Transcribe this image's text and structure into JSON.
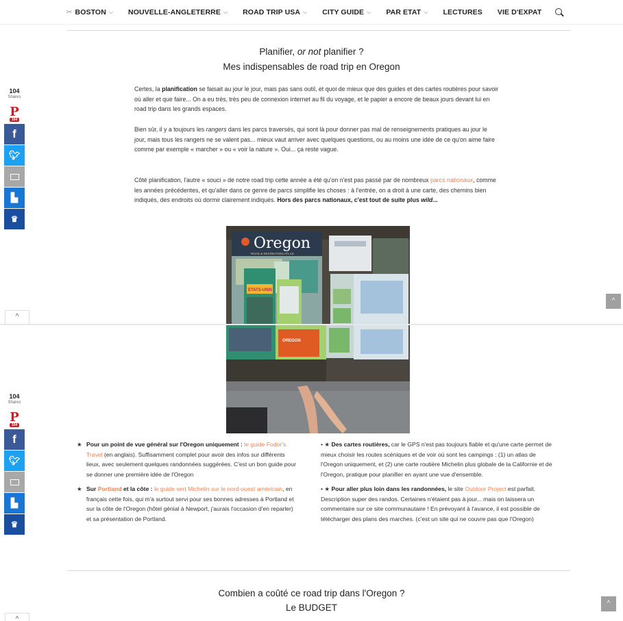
{
  "nav": {
    "items": [
      {
        "label": "BOSTON",
        "prefix": "✂",
        "dropdown": true
      },
      {
        "label": "NOUVELLE-ANGLETERRE",
        "dropdown": true
      },
      {
        "label": "ROAD TRIP USA",
        "dropdown": true
      },
      {
        "label": "CITY GUIDE",
        "dropdown": true
      },
      {
        "label": "PAR ETAT",
        "dropdown": true
      },
      {
        "label": "LECTURES",
        "dropdown": false
      },
      {
        "label": "VIE D'EXPAT",
        "dropdown": false
      }
    ],
    "search_icon": "search-icon"
  },
  "share": {
    "count": "104",
    "label": "Shares",
    "pin_count": "104",
    "buttons": [
      "pinterest",
      "facebook",
      "twitter",
      "email",
      "flipboard",
      "crown"
    ],
    "colors": {
      "pinterest": "#cb2027",
      "facebook": "#3b5998",
      "twitter": "#1da1f2",
      "email": "#a8a8a8",
      "flipboard": "#1877d4",
      "crown": "#1a4fa0"
    }
  },
  "section1": {
    "title_a": "Planifier, ",
    "title_em": "or not",
    "title_b": " planifier ?",
    "subtitle": "Mes indispensables de road trip en Oregon",
    "p1_a": "Certes, la ",
    "p1_bold": "planification",
    "p1_b": " se faisait au jour le jour, mais pas sans outil, et quoi de mieux que des guides et des cartes routières pour savoir où aller et que faire... On a eu très, très peu de connexion internet au fil du voyage, et le papier a encore de beaux jours devant lui en road trip dans les grands espaces.",
    "p2_a": "Bien sûr, il y a toujours les ",
    "p2_em": "rangers",
    "p2_b": " dans les parcs traversés, qui sont là pour donner pas mal de renseignements pratiques au jour le jour, mais tous les rangers ne se valent pas... mieux vaut arriver avec quelques questions, ou au moins une idée de ce qu'on aime faire comme par exemple « marcher » ou « voir la nature ». Oui... ça reste vague.",
    "p3_a": "Côté planification, l'autre « souci » de notre road trip cette année a été qu'on n'est pas passé par de nombreux ",
    "p3_link": "parcs nationaux",
    "p3_b": ", comme les années précédentes, et qu'aller dans ce genre de parcs simplifie les choses : à l'entrée, on a droit à une carte, des chemins bien indiqués, des endroits où dormir clairement indiqués. ",
    "p3_bold": "Hors des parcs nationaux, c'est tout de suite plus ",
    "p3_bold_em": "wild",
    "p3_end": "...",
    "photo_title": "Oregon",
    "photo_subtitle": "ROAD & RECREATION ATLAS",
    "photo_label2": "ETATS-UNIS",
    "photo_label3": "OREGON"
  },
  "left_list": [
    {
      "bold": "Pour un point de vue général sur l'Oregon uniquement : ",
      "link": "le guide Fodor's Travel",
      "rest": " (en anglais). Suffisamment complet pour avoir des infos sur différents lieux, avec seulement quelques randonnées suggérées. C'est un bon guide pour se donner une première idée de l'Oregon"
    },
    {
      "bold": "Sur ",
      "link_inline": "Portland",
      "bold2": " et la côte : ",
      "link": "le guide vert Michelin sur le nord-ouest américain",
      "rest": ", en français cette fois, qui m'a surtout servi pour ses bonnes adresses à Portland et sur la côte de l'Oregon (hôtel génial à Newport, j'aurais l'occasion d'en reparler) et sa présentation de Portland."
    }
  ],
  "right_list": [
    {
      "prefix": "• ★ ",
      "bold": "Des cartes routières,",
      "rest": " car le GPS n'est pas toujours fiable et qu'une carte permet de mieux choisir les routes scéniques et de voir où sont les campings : (1) un atlas de l'Oregon uniquement, et (2) une carte routière Michelin plus globale de la Californie et de l'Oregon, pratique pour planifier en ayant une vue d'ensemble."
    },
    {
      "prefix": "• ★ ",
      "bold": "Pour aller plus loin dans les randonnées,",
      "rest_a": " le site ",
      "link": "Outdoor Project",
      "rest": " est parfait. Description super des randos. Certaines n'étaient pas à jour... mais on laissera un commentaire sur ce site communautaire ! En prévoyant à l'avance, il est possible de télécharger des plans des marches. (c'est un site qui ne couvre pas que l'Oregon)"
    }
  ],
  "section2": {
    "title": "Combien a coûté ce road trip dans l'Oregon ?",
    "subtitle": "Le BUDGET"
  },
  "controls": {
    "up_label": "^",
    "scroll_top_label": "^"
  }
}
